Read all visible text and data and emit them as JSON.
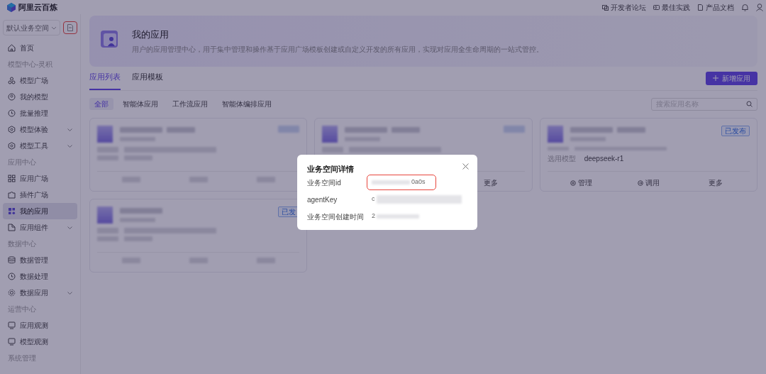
{
  "header": {
    "logo": "阿里云百炼",
    "links": [
      {
        "label": "开发者论坛"
      },
      {
        "label": "最佳实践"
      },
      {
        "label": "产品文档"
      }
    ]
  },
  "sidebar": {
    "workspace": "默认业务空间",
    "workspace_button_highlighted": true,
    "items": [
      {
        "kind": "item",
        "label": "首页",
        "selected": false,
        "has_submenu": false
      },
      {
        "kind": "section",
        "label": "模型中心-灵积"
      },
      {
        "kind": "item",
        "label": "模型广场",
        "selected": false,
        "has_submenu": false
      },
      {
        "kind": "item",
        "label": "我的模型",
        "selected": false,
        "has_submenu": false
      },
      {
        "kind": "item",
        "label": "批量推理",
        "selected": false,
        "has_submenu": false
      },
      {
        "kind": "item",
        "label": "模型体验",
        "selected": false,
        "has_submenu": true
      },
      {
        "kind": "item",
        "label": "模型工具",
        "selected": false,
        "has_submenu": true
      },
      {
        "kind": "section",
        "label": "应用中心"
      },
      {
        "kind": "item",
        "label": "应用广场",
        "selected": false,
        "has_submenu": false
      },
      {
        "kind": "item",
        "label": "插件广场",
        "selected": false,
        "has_submenu": false
      },
      {
        "kind": "item",
        "label": "我的应用",
        "selected": true,
        "has_submenu": false
      },
      {
        "kind": "item",
        "label": "应用组件",
        "selected": false,
        "has_submenu": true
      },
      {
        "kind": "section",
        "label": "数据中心"
      },
      {
        "kind": "item",
        "label": "数据管理",
        "selected": false,
        "has_submenu": false
      },
      {
        "kind": "item",
        "label": "数据处理",
        "selected": false,
        "has_submenu": false
      },
      {
        "kind": "item",
        "label": "数据应用",
        "selected": false,
        "has_submenu": true
      },
      {
        "kind": "section",
        "label": "运营中心"
      },
      {
        "kind": "item",
        "label": "应用观测",
        "selected": false,
        "has_submenu": false
      },
      {
        "kind": "item",
        "label": "模型观测",
        "selected": false,
        "has_submenu": false
      },
      {
        "kind": "section",
        "label": "系统管理"
      }
    ]
  },
  "page": {
    "title": "我的应用",
    "description": "用户的应用管理中心，用于集中管理和操作基于应用广场模板创建或自定义开发的所有应用，实现对应用全生命周期的一站式管控。",
    "tabs": [
      {
        "label": "应用列表",
        "selected": true
      },
      {
        "label": "应用模板",
        "selected": false
      }
    ],
    "new_button": "新增应用",
    "filters": [
      {
        "label": "全部",
        "selected": true
      },
      {
        "label": "智能体应用",
        "selected": false
      },
      {
        "label": "工作流应用",
        "selected": false
      },
      {
        "label": "智能体编排应用",
        "selected": false
      }
    ],
    "search": {
      "placeholder": "搜索应用名称"
    },
    "cards": [
      {
        "status_blurred": true,
        "actions_blurred": true
      },
      {
        "status_blurred": true,
        "actions_blurred": false,
        "actions": [
          {
            "kind": "plain",
            "label": "更多"
          }
        ]
      },
      {
        "status": "已发布",
        "status_blurred": false,
        "model_label": "选用模型",
        "model": "deepseek-r1",
        "actions_blurred": false,
        "actions": [
          {
            "kind": "manage",
            "label": "管理"
          },
          {
            "kind": "invoke",
            "label": "调用"
          },
          {
            "kind": "plain",
            "label": "更多"
          }
        ]
      },
      {
        "status": "已发",
        "status_blurred": false,
        "actions_blurred": true
      }
    ]
  },
  "modal": {
    "title": "业务空间详情",
    "rows": [
      {
        "label": "业务空间id",
        "value": "0a0s",
        "redacted": true,
        "highlighted": true
      },
      {
        "label": "agentKey",
        "value": "c",
        "redacted": true,
        "highlighted": false
      },
      {
        "label": "业务空间创建时间",
        "value": "2",
        "redacted": true,
        "highlighted": false
      }
    ]
  }
}
